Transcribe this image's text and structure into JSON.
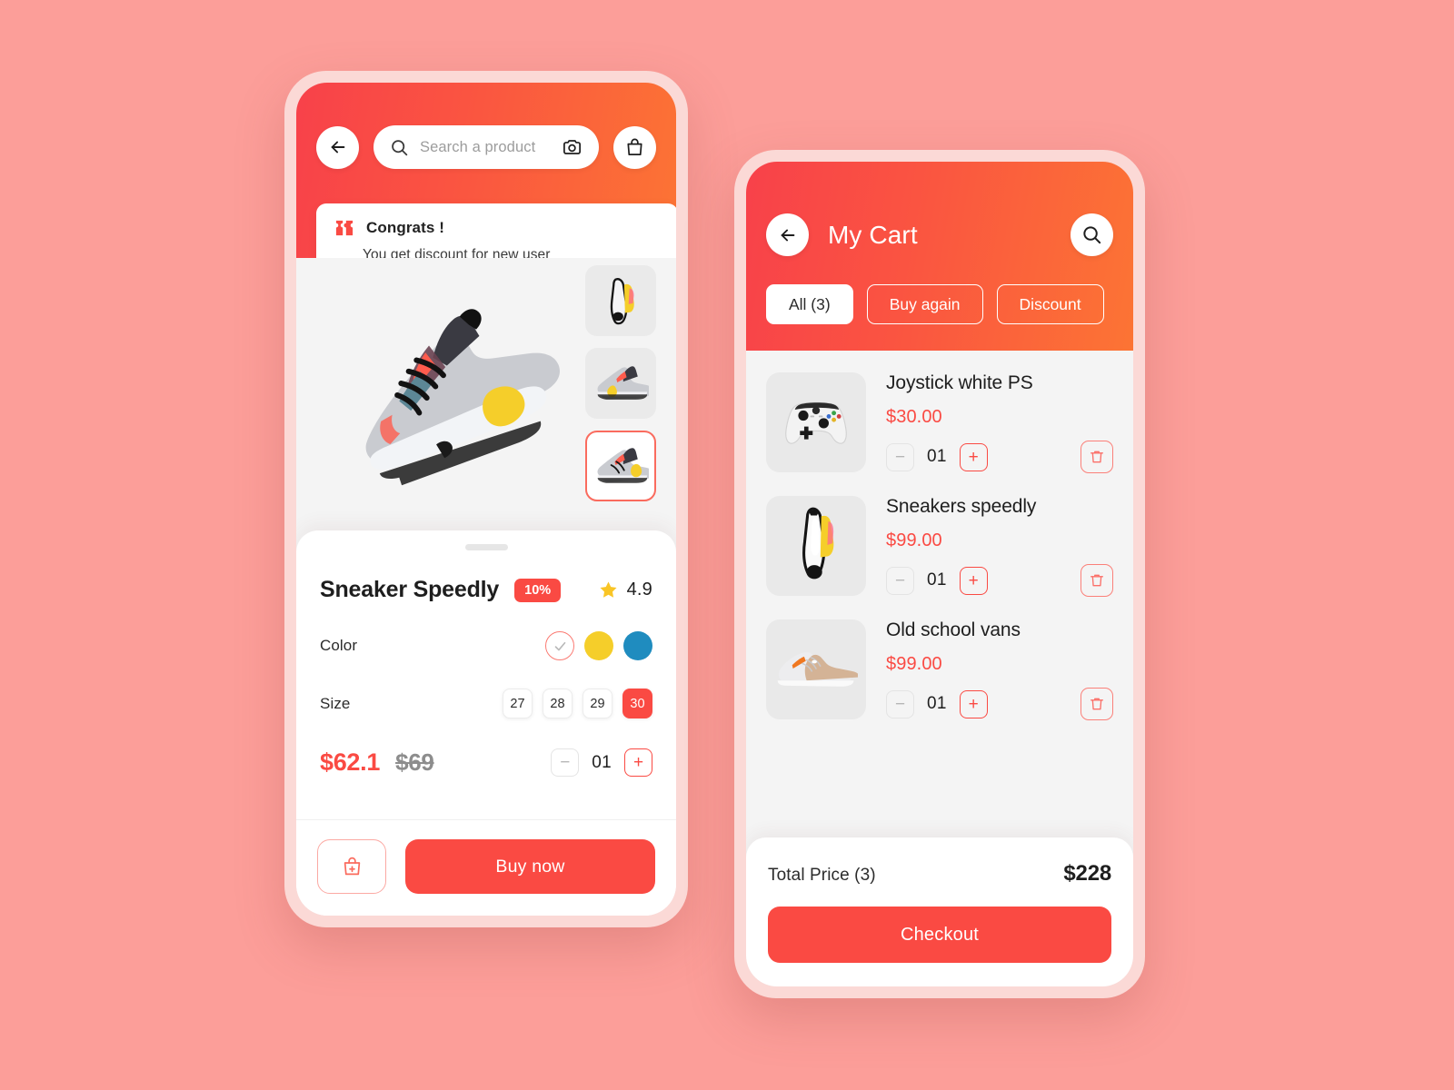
{
  "theme": {
    "background": "#FC9E99",
    "phone_frame": "#FBD9D6",
    "accent_red": "#FA4A43",
    "gradient_start": "#F8414A",
    "gradient_end": "#FC7434",
    "swatch_yellow": "#F5CE2A",
    "swatch_blue": "#1F8CBF"
  },
  "product_screen": {
    "back_icon": "arrow-left-icon",
    "search": {
      "placeholder": "Search a product",
      "value": "",
      "search_icon": "search-icon",
      "camera_icon": "camera-icon"
    },
    "bag_icon": "shopping-bag-icon",
    "banner": {
      "ticket_icon": "ticket-icon",
      "title": "Congrats !",
      "subtitle": "You get discount for new user"
    },
    "gallery": {
      "hero_alt": "sneaker-hero-image",
      "thumbnails": [
        {
          "alt": "sneaker-top-view",
          "selected": false
        },
        {
          "alt": "sneaker-side-view",
          "selected": false
        },
        {
          "alt": "sneaker-angle-view",
          "selected": true
        }
      ]
    },
    "details": {
      "title": "Sneaker Speedly",
      "discount_badge": "10%",
      "star_icon": "star-icon",
      "rating": "4.9",
      "color_label": "Color",
      "colors": [
        {
          "name": "white",
          "hex": "#FFFFFF",
          "selected": true
        },
        {
          "name": "yellow",
          "hex": "#F5CE2A",
          "selected": false
        },
        {
          "name": "blue",
          "hex": "#1F8CBF",
          "selected": false
        }
      ],
      "size_label": "Size",
      "sizes": [
        {
          "value": "27",
          "selected": false
        },
        {
          "value": "28",
          "selected": false
        },
        {
          "value": "29",
          "selected": false
        },
        {
          "value": "30",
          "selected": true
        }
      ],
      "price_current": "$62.1",
      "price_original": "$69",
      "quantity": "01",
      "minus_label": "−",
      "plus_label": "+"
    },
    "cta": {
      "bag_icon": "add-to-bag-icon",
      "buy_label": "Buy now"
    }
  },
  "cart_screen": {
    "back_icon": "arrow-left-icon",
    "title": "My Cart",
    "search_icon": "search-icon",
    "tabs": [
      {
        "label": "All (3)",
        "active": true
      },
      {
        "label": "Buy again",
        "active": false
      },
      {
        "label": "Discount",
        "active": false
      }
    ],
    "items": [
      {
        "name": "Joystick white PS",
        "price": "$30.00",
        "quantity": "01",
        "thumb_alt": "joystick-image",
        "minus_label": "−",
        "plus_label": "+",
        "trash_icon": "trash-icon"
      },
      {
        "name": "Sneakers speedly",
        "price": "$99.00",
        "quantity": "01",
        "thumb_alt": "sneakers-top-image",
        "minus_label": "−",
        "plus_label": "+",
        "trash_icon": "trash-icon"
      },
      {
        "name": "Old school vans",
        "price": "$99.00",
        "quantity": "01",
        "thumb_alt": "vans-shoe-image",
        "minus_label": "−",
        "plus_label": "+",
        "trash_icon": "trash-icon"
      }
    ],
    "footer": {
      "total_label": "Total Price (3)",
      "total_value": "$228",
      "checkout_label": "Checkout"
    }
  }
}
